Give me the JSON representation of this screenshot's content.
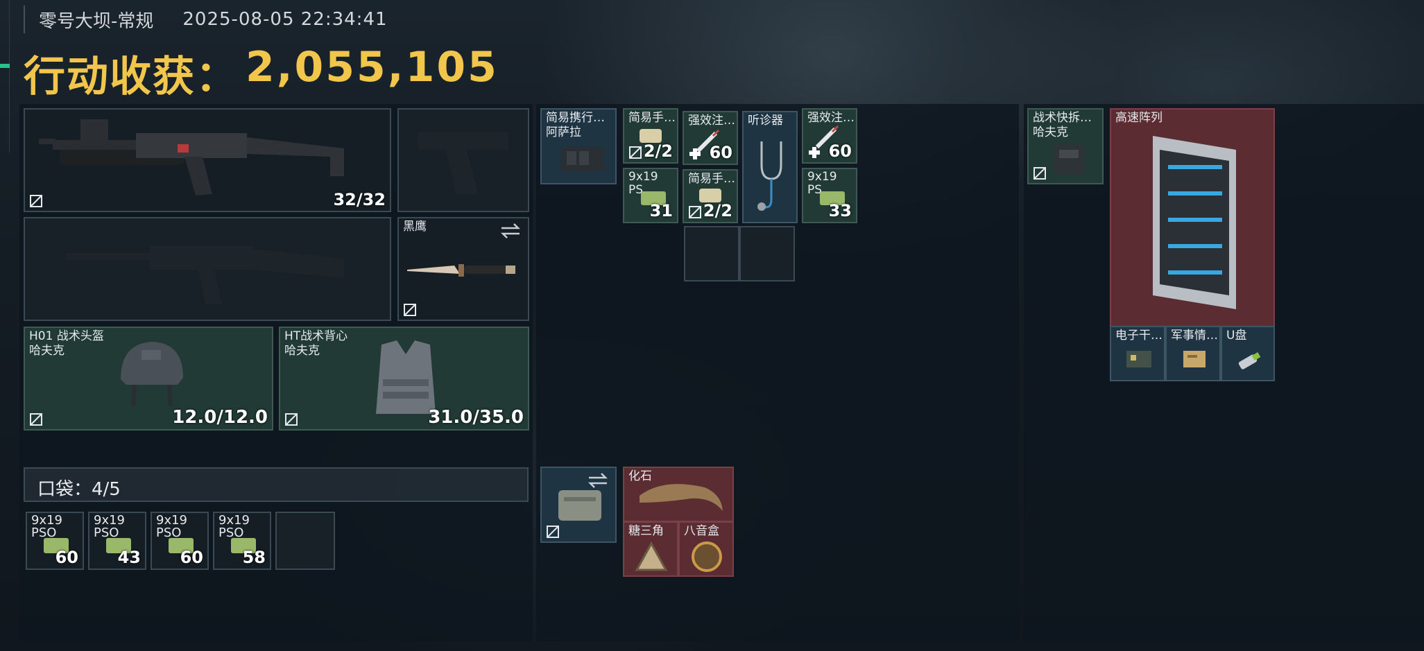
{
  "header": {
    "mode": "零号大坝-常规",
    "timestamp": "2025-08-05 22:34:41",
    "title_label": "行动收获：",
    "title_value": "2,055,105"
  },
  "loadout": {
    "primary_weapon": {
      "count": "32/32"
    },
    "melee": {
      "label": "黑鹰"
    },
    "helmet": {
      "label": "H01 战术头盔",
      "sublabel": "哈夫克",
      "durability": "12.0/12.0"
    },
    "armor": {
      "label": "HT战术背心",
      "sublabel": "哈夫克",
      "durability": "31.0/35.0"
    },
    "pocket": {
      "label": "口袋：4/5"
    },
    "pocket_items": [
      {
        "label": "9x19",
        "sublabel": "PSO",
        "count": "60"
      },
      {
        "label": "9x19",
        "sublabel": "PSO",
        "count": "43"
      },
      {
        "label": "9x19",
        "sublabel": "PSO",
        "count": "60"
      },
      {
        "label": "9x19",
        "sublabel": "PSO",
        "count": "58"
      }
    ]
  },
  "rig": {
    "rig_slot": {
      "label": "简易携行…",
      "sublabel": "阿萨拉"
    },
    "items": [
      {
        "label": "简易手…",
        "count": "2/2"
      },
      {
        "label": "强效注…",
        "count": "60"
      },
      {
        "label": "听诊器"
      },
      {
        "label": "强效注…",
        "count": "60"
      },
      {
        "label": "9x19",
        "sublabel": "PS",
        "count": "31"
      },
      {
        "label": "简易手…",
        "count": "2/2"
      },
      {
        "label": "9x19",
        "sublabel": "PS",
        "count": "33"
      }
    ]
  },
  "case": {
    "items": [
      {
        "label": "化石"
      },
      {
        "label": "糖三角"
      },
      {
        "label": "八音盒"
      }
    ]
  },
  "backpack": {
    "slot": {
      "label": "战术快拆…",
      "sublabel": "哈夫克"
    },
    "items": [
      {
        "label": "高速阵列"
      },
      {
        "label": "电子干…"
      },
      {
        "label": "军事情…"
      },
      {
        "label": "U盘"
      }
    ]
  },
  "colors": {
    "title": "#f2c64a",
    "green_slot": "#213a35",
    "red_slot": "#5b2c32",
    "blue_slot": "#1f3443",
    "accent": "#27c28a"
  }
}
